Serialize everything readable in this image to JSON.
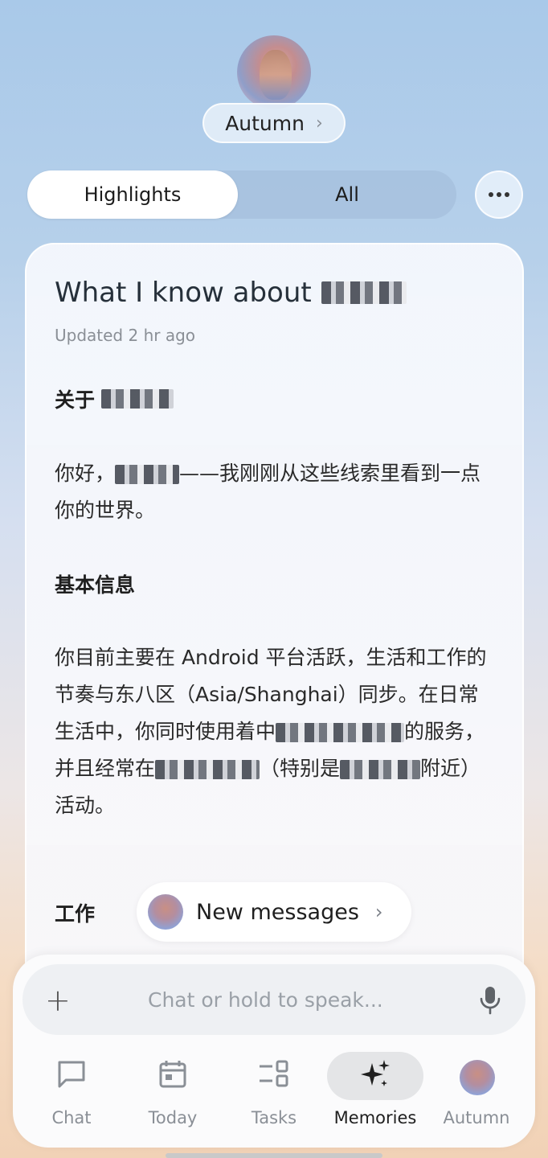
{
  "header": {
    "name": "Autumn",
    "name_chevron": "›"
  },
  "tabs": [
    {
      "label": "Highlights",
      "active": true
    },
    {
      "label": "All",
      "active": false
    }
  ],
  "card": {
    "title": "What I know about",
    "updated": "Updated 2 hr ago",
    "section_about": "关于",
    "greeting_prefix": "你好，",
    "greeting_suffix": "——我刚刚从这些线索里看到一点你的世界。",
    "section_basic": "基本信息",
    "basic_text_1": "你目前主要在 Android 平台活跃，生活和工作的节奏与东八区（Asia/Shanghai）同步。在日常生活中，你同时使用着中",
    "basic_text_2": "的服务，并且经常在",
    "basic_text_3": "（特别是",
    "basic_text_4": "附近）活动。",
    "section_work": "工作"
  },
  "new_messages": {
    "label": "New messages",
    "chevron": "›"
  },
  "composer": {
    "plus": "+",
    "placeholder": "Chat or hold to speak..."
  },
  "nav": [
    {
      "label": "Chat",
      "icon": "chat-bubble-icon",
      "active": false
    },
    {
      "label": "Today",
      "icon": "calendar-icon",
      "active": false
    },
    {
      "label": "Tasks",
      "icon": "tasks-icon",
      "active": false
    },
    {
      "label": "Memories",
      "icon": "sparkle-icon",
      "active": true
    },
    {
      "label": "Autumn",
      "icon": "avatar",
      "active": false
    }
  ]
}
